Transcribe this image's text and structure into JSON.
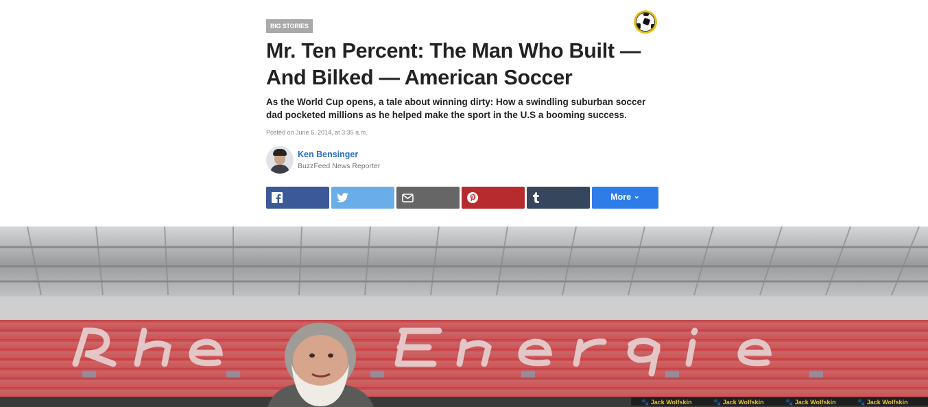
{
  "article": {
    "category": "BIG STORIES",
    "title_line1": "Mr. Ten Percent: The Man Who Built —",
    "title_line2": "And Bilked — American Soccer",
    "dek_line1": "As the World Cup opens, a tale about winning dirty: How a swindling suburban soccer",
    "dek_line2": "dad pocketed millions as he helped make the sport in the U.S a booming success.",
    "posted": "Posted on June 6, 2014, at 3:35 a.m."
  },
  "author": {
    "name": "Ken Bensinger",
    "role": "BuzzFeed News Reporter"
  },
  "share": {
    "more_label": "More",
    "more_caret": "⌄",
    "buttons": [
      {
        "network": "facebook",
        "icon": "facebook-icon",
        "color": "#3b5998"
      },
      {
        "network": "twitter",
        "icon": "twitter-icon",
        "color": "#6aaee8"
      },
      {
        "network": "email",
        "icon": "envelope-icon",
        "color": "#666666"
      },
      {
        "network": "pinterest",
        "icon": "pinterest-icon",
        "color": "#b72a2e"
      },
      {
        "network": "tumblr",
        "icon": "tumblr-icon",
        "color": "#36465d"
      }
    ],
    "more_color": "#2e7ce7"
  },
  "hero": {
    "stadium_lettering": "RheinEnergie",
    "banner_text": "Jack Wolfskin"
  }
}
